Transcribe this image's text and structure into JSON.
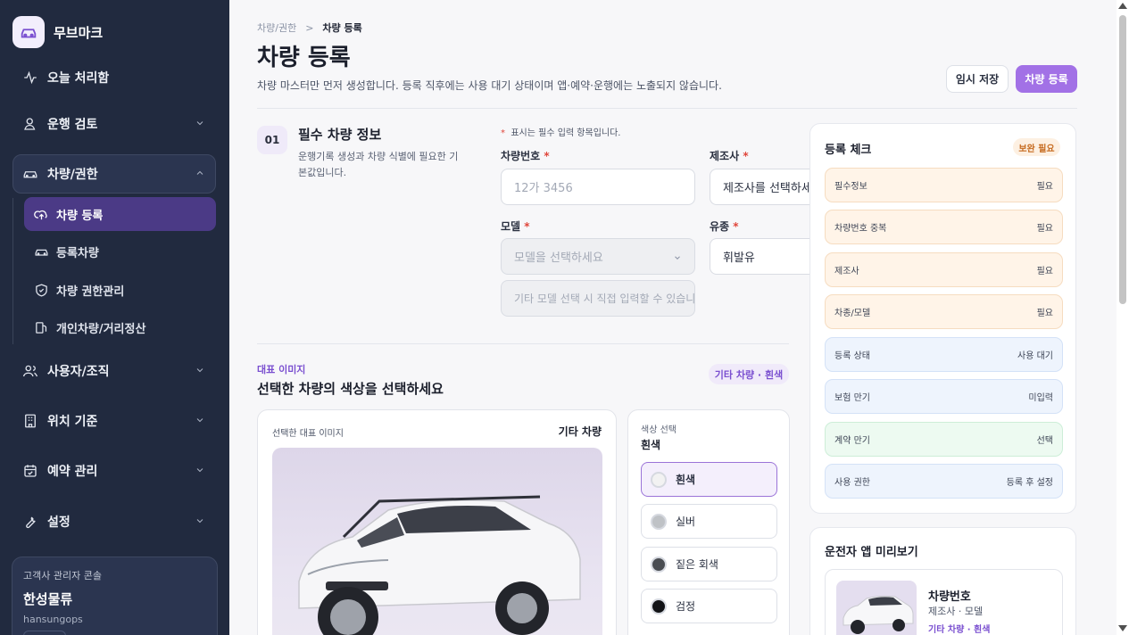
{
  "sidebar": {
    "brand": "무브마크",
    "items": [
      {
        "label": "오늘 처리함"
      },
      {
        "label": "운행 검토"
      },
      {
        "label": "차량/권한"
      },
      {
        "label": "사용자/조직"
      },
      {
        "label": "위치 기준"
      },
      {
        "label": "예약 관리"
      },
      {
        "label": "설정"
      }
    ],
    "sub_items": [
      {
        "label": "차량 등록"
      },
      {
        "label": "등록차량"
      },
      {
        "label": "차량 권한관리"
      },
      {
        "label": "개인차량/거리정산"
      }
    ],
    "console": {
      "label": "고객사 관리자 콘솔",
      "company": "한성물류",
      "user": "hansungops"
    }
  },
  "header": {
    "breadcrumb_parent": "차량/권한",
    "breadcrumb_sep": ">",
    "breadcrumb_current": "차량 등록",
    "title": "차량 등록",
    "description": "차량 마스터만 먼저 생성합니다. 등록 직후에는 사용 대기 상태이며 앱·예약·운행에는 노출되지 않습니다.",
    "temp_save_label": "임시 저장",
    "register_label": "차량 등록"
  },
  "section1": {
    "step": "01",
    "title": "필수 차량 정보",
    "description": "운행기록 생성과 차량 식별에 필요한 기본값입니다.",
    "required_note": "표시는 필수 입력 항목입니다.",
    "star": "*",
    "plate": {
      "label": "차량번호",
      "placeholder": "12가 3456"
    },
    "maker": {
      "label": "제조사",
      "value": "제조사를 선택하세요"
    },
    "model": {
      "label": "모델",
      "value": "모델을 선택하세요"
    },
    "fuel": {
      "label": "유종",
      "value": "휘발유"
    },
    "custom_model_placeholder": "기타 모델 선택 시 직접 입력할 수 있습니다"
  },
  "image_section": {
    "kicker": "대표 이미지",
    "title": "선택한 차량의 색상을 선택하세요",
    "tag": "기타 차량 · 흰색",
    "card_label": "선택한 대표 이미지",
    "card_name": "기타 차량",
    "color_label": "색상 선택",
    "color_value": "흰색",
    "colors": [
      {
        "label": "흰색",
        "hex": "#f2f2f2",
        "selected": true
      },
      {
        "label": "실버",
        "hex": "#bfc2c6",
        "selected": false
      },
      {
        "label": "짙은 회색",
        "hex": "#4a4d52",
        "selected": false
      },
      {
        "label": "검정",
        "hex": "#121316",
        "selected": false
      }
    ]
  },
  "check": {
    "title": "등록 체크",
    "badge": "보완 필요",
    "rows": [
      {
        "label": "필수정보",
        "value": "필요",
        "status": "warn"
      },
      {
        "label": "차량번호 중복",
        "value": "필요",
        "status": "warn"
      },
      {
        "label": "제조사",
        "value": "필요",
        "status": "warn"
      },
      {
        "label": "차종/모델",
        "value": "필요",
        "status": "warn"
      },
      {
        "label": "등록 상태",
        "value": "사용 대기",
        "status": "info"
      },
      {
        "label": "보험 만기",
        "value": "미입력",
        "status": "info"
      },
      {
        "label": "계약 만기",
        "value": "선택",
        "status": "ok"
      },
      {
        "label": "사용 권한",
        "value": "등록 후 설정",
        "status": "info"
      }
    ]
  },
  "preview": {
    "title": "운전자 앱 미리보기",
    "plate": "차량번호",
    "model": "제조사 · 모델",
    "color": "기타 차량 · 흰색"
  },
  "colors": {
    "accent": "#a271e6",
    "sidebar_bg": "#212a3f",
    "active_item": "#4b3a86",
    "required": "#e0463b"
  }
}
